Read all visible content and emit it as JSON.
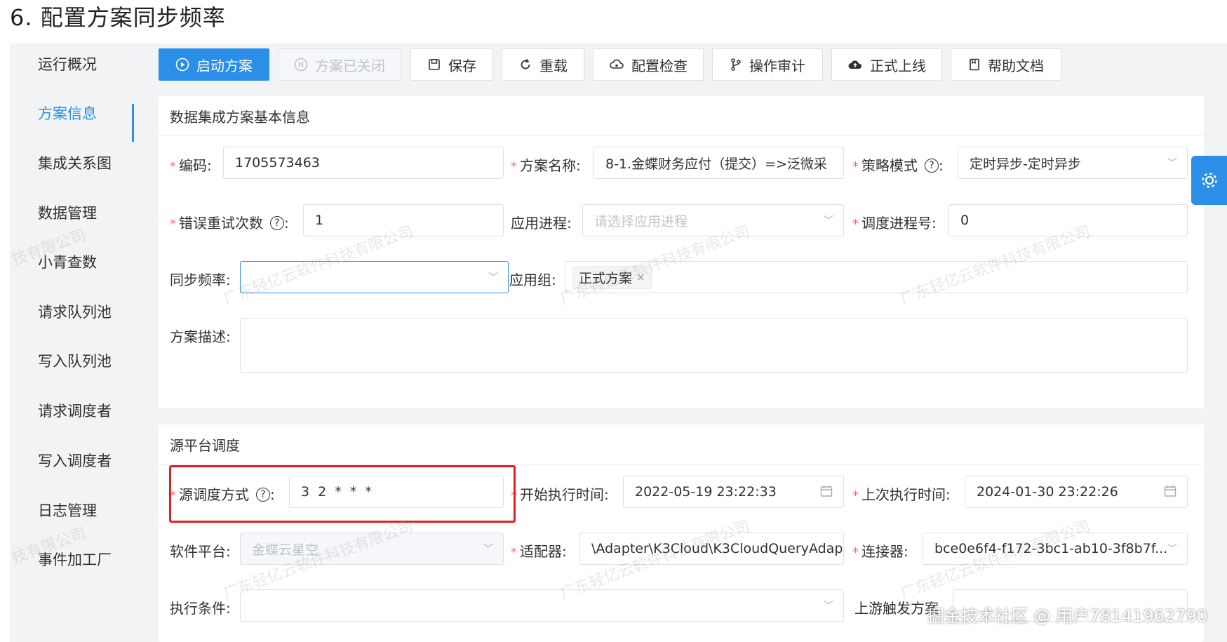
{
  "heading": "6. 配置方案同步频率",
  "sidebar": {
    "items": [
      {
        "label": "运行概况"
      },
      {
        "label": "方案信息"
      },
      {
        "label": "集成关系图"
      },
      {
        "label": "数据管理"
      },
      {
        "label": "小青查数"
      },
      {
        "label": "请求队列池"
      },
      {
        "label": "写入队列池"
      },
      {
        "label": "请求调度者"
      },
      {
        "label": "写入调度者"
      },
      {
        "label": "日志管理"
      },
      {
        "label": "事件加工厂"
      }
    ],
    "active": "方案信息"
  },
  "toolbar": {
    "start": "启动方案",
    "closed": "方案已关闭",
    "save": "保存",
    "reload": "重载",
    "check": "配置检查",
    "audit": "操作审计",
    "publish": "正式上线",
    "help": "帮助文档"
  },
  "basic": {
    "title": "数据集成方案基本信息",
    "code_label": "编码:",
    "code_value": "1705573463",
    "name_label": "方案名称:",
    "name_value": "8-1.金蝶财务应付（提交）=>泛微采",
    "strategy_label": "策略模式",
    "strategy_value": "定时异步-定时异步",
    "retry_label": "错误重试次数",
    "retry_value": "1",
    "process_label": "应用进程:",
    "process_placeholder": "请选择应用进程",
    "sched_label": "调度进程号:",
    "sched_value": "0",
    "freq_label": "同步频率:",
    "freq_value": "",
    "group_label": "应用组:",
    "group_tag": "正式方案",
    "desc_label": "方案描述:"
  },
  "source": {
    "title": "源平台调度",
    "mode_label": "源调度方式",
    "mode_value": "3 2 * * *",
    "start_label": "开始执行时间:",
    "start_value": "2022-05-19 23:22:33",
    "last_label": "上次执行时间:",
    "last_value": "2024-01-30 23:22:26",
    "platform_label": "软件平台:",
    "platform_value": "金蝶云星空",
    "adapter_label": "适配器:",
    "adapter_value": "\\Adapter\\K3Cloud\\K3CloudQueryAdap",
    "connector_label": "连接器:",
    "connector_value": "bce0e6f4-f172-3bc1-ab10-3f8b7f...",
    "cond_label": "执行条件:",
    "upstream_label": "上游触发方案"
  },
  "watermark_text": "广东轻亿云软件科技有限公司",
  "watermark_fragment": "技有限公司",
  "footer": "掘金技术社区 @ 用户78141962790",
  "colors": {
    "primary": "#2b8fe8",
    "required": "#f56c6c",
    "highlight": "#e02020"
  }
}
